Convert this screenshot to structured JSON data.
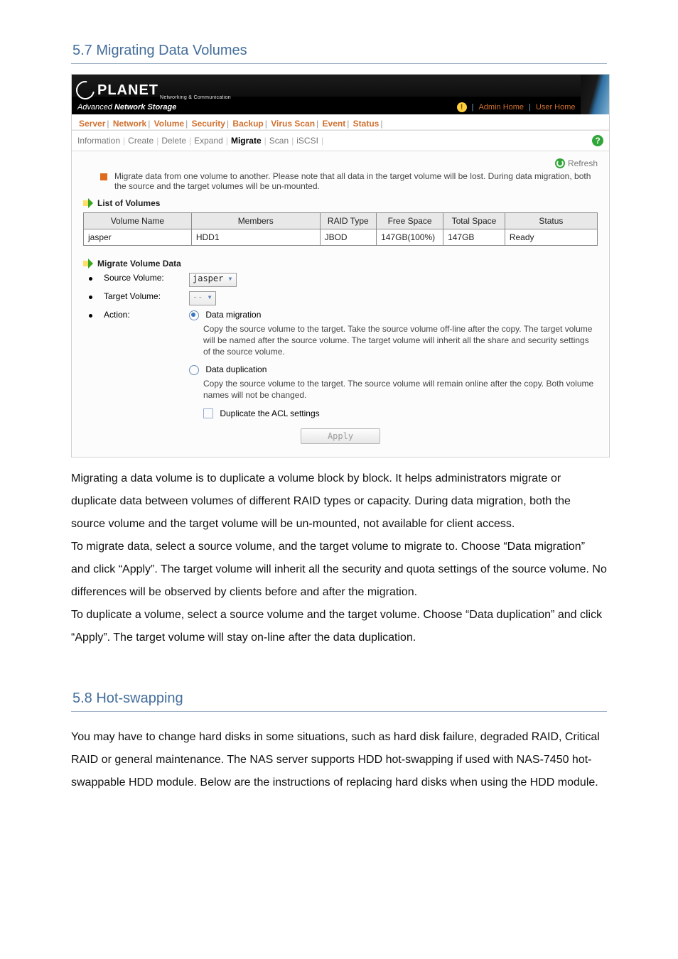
{
  "sections": {
    "s57_title": "5.7 Migrating Data Volumes",
    "s58_title": "5.8 Hot-swapping"
  },
  "header": {
    "brand_word": "PLANET",
    "brand_tag": "Networking & Communication",
    "product_title_pre": "Advanced ",
    "product_title_bold": "Network Storage",
    "admin_home": "Admin Home",
    "user_home": "User Home",
    "help": "Help"
  },
  "nav1": {
    "items": [
      "Server",
      "Network",
      "Volume",
      "Security",
      "Backup",
      "Virus Scan",
      "Event",
      "Status"
    ],
    "active_index": 2
  },
  "nav2": {
    "items": [
      "Information",
      "Create",
      "Delete",
      "Expand",
      "Migrate",
      "Scan",
      "iSCSI"
    ],
    "active_index": 4
  },
  "refresh_label": "Refresh",
  "note_text": "Migrate data from one volume to another. Please note that all data in the target volume will be lost. During data migration, both the source and the target volumes will be un-mounted.",
  "list_heading": "List of Volumes",
  "table": {
    "headers": [
      "Volume Name",
      "Members",
      "RAID Type",
      "Free Space",
      "Total Space",
      "Status"
    ],
    "rows": [
      {
        "name": "jasper",
        "members": "HDD1",
        "raid": "JBOD",
        "free": "147GB(100%)",
        "total": "147GB",
        "status": "Ready"
      }
    ]
  },
  "migrate": {
    "heading": "Migrate Volume Data",
    "source_label": "Source Volume:",
    "source_value": "jasper",
    "target_label": "Target Volume:",
    "target_value": "--",
    "action_label": "Action:",
    "opt1_title": "Data migration",
    "opt1_desc": "Copy the source volume to the target. Take the source volume off-line after the copy. The target volume will be named after the source volume. The target volume will inherit all the share and security settings of the source volume.",
    "opt2_title": "Data duplication",
    "opt2_desc": "Copy the source volume to the target. The source volume will remain online after the copy. Both volume names will not be changed.",
    "dup_acl_label": "Duplicate the ACL settings",
    "apply_label": "Apply"
  },
  "body_text": {
    "p1": "Migrating a data volume is to duplicate a volume block by block. It helps administrators migrate or duplicate data between volumes of different RAID types or capacity. During data migration, both the source volume and the target volume will be un-mounted, not available for client access.",
    "p2": "To migrate data, select a source volume, and the target volume to migrate to. Choose “Data migration” and click “Apply”. The target volume will inherit all the security and quota settings of the source volume. No differences will be observed by clients before and after the migration.",
    "p3": "To duplicate a volume, select a source volume and the target volume. Choose “Data duplication” and click “Apply”. The target volume will stay on-line after the data duplication.",
    "p4": "You may have to change hard disks in some situations, such as hard disk failure, degraded RAID, Critical RAID or general maintenance. The NAS server supports HDD hot-swapping if used with NAS-7450 hot-swappable HDD module. Below are the instructions of replacing hard disks when using the HDD module."
  }
}
